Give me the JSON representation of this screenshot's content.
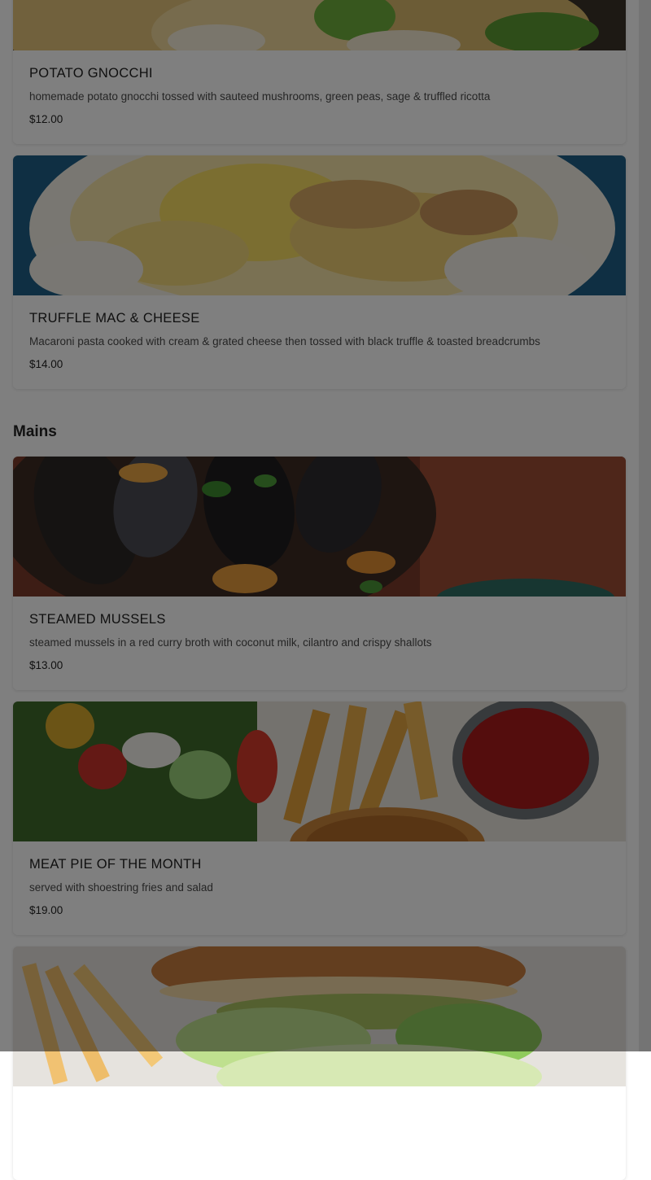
{
  "sections": {
    "mains": {
      "heading": "Mains"
    }
  },
  "items": [
    {
      "name": "POTATO GNOCCHI",
      "description": "homemade potato gnocchi tossed with sauteed mushrooms, green peas, sage & truffled ricotta",
      "price": "$12.00"
    },
    {
      "name": "TRUFFLE MAC & CHEESE",
      "description": "Macaroni pasta cooked with cream & grated cheese then tossed with black truffle & toasted breadcrumbs",
      "price": "$14.00"
    },
    {
      "name": "STEAMED MUSSELS",
      "description": "steamed mussels in a red curry broth with coconut milk, cilantro and crispy shallots",
      "price": "$13.00"
    },
    {
      "name": "MEAT PIE OF THE MONTH",
      "description": "served with shoestring fries and salad",
      "price": "$19.00"
    }
  ],
  "colors": {
    "overlay": "rgba(0,0,0,0.5)",
    "card_background": "#ffffff",
    "page_background": "#ffffff"
  }
}
